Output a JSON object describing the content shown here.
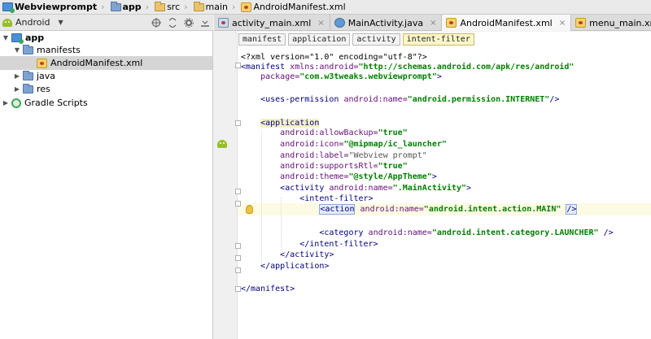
{
  "breadcrumbs": [
    {
      "label": "Webviewprompt",
      "icon": "module-icon",
      "bold": true
    },
    {
      "label": "app",
      "icon": "folder-icon",
      "bold": true
    },
    {
      "label": "src",
      "icon": "folder-icon",
      "bold": false
    },
    {
      "label": "main",
      "icon": "folder-icon",
      "bold": false
    },
    {
      "label": "AndroidManifest.xml",
      "icon": "xml-file-icon",
      "bold": false
    }
  ],
  "project_panel": {
    "view_label": "Android",
    "tree": [
      {
        "label": "app",
        "indent": 0,
        "arrow": "▼",
        "icon": "module-icon",
        "selected": false
      },
      {
        "label": "manifests",
        "indent": 1,
        "arrow": "▼",
        "icon": "folder-icon",
        "selected": false
      },
      {
        "label": "AndroidManifest.xml",
        "indent": 2,
        "arrow": "",
        "icon": "xml-file-icon",
        "selected": true
      },
      {
        "label": "java",
        "indent": 1,
        "arrow": "▶",
        "icon": "folder-icon",
        "selected": false
      },
      {
        "label": "res",
        "indent": 1,
        "arrow": "▶",
        "icon": "folder-icon",
        "selected": false
      },
      {
        "label": "Gradle Scripts",
        "indent": 0,
        "arrow": "▶",
        "icon": "gradle-icon",
        "selected": false
      }
    ]
  },
  "tabs": [
    {
      "label": "activity_main.xml",
      "icon": "layout-file-icon",
      "active": false
    },
    {
      "label": "MainActivity.java",
      "icon": "java-file-icon",
      "active": false
    },
    {
      "label": "AndroidManifest.xml",
      "icon": "xml-file-icon",
      "active": true
    },
    {
      "label": "menu_main.xml",
      "icon": "menu-file-icon",
      "active": false
    }
  ],
  "tab_close_glyph": "×",
  "xml_breadcrumbs": [
    "manifest",
    "application",
    "activity",
    "intent-filter"
  ],
  "code": {
    "l1": "<?xml version=\"1.0\" encoding=\"utf-8\"?>",
    "l2_tag": "<manifest",
    "l2_attr": "xmlns:android=",
    "l2_val": "\"http://schemas.android.com/apk/res/android\"",
    "l3_attr": "package=",
    "l3_val": "\"com.w3tweaks.webviewprompt\"",
    "l3_end": ">",
    "l5_tag": "<uses-permission",
    "l5_attr": "android:name=",
    "l5_val": "\"android.permission.INTERNET\"",
    "l5_end": "/>",
    "l7_tag": "<application",
    "l8_attr": "android:allowBackup=",
    "l8_val": "\"true\"",
    "l9_attr": "android:icon=",
    "l9_val": "\"@mipmap/ic_launcher\"",
    "l10_attr": "android:label=",
    "l10_val": "\"Webview prompt\"",
    "l11_attr": "android:supportsRtl=",
    "l11_val": "\"true\"",
    "l12_attr": "android:theme=",
    "l12_val": "\"@style/AppTheme\"",
    "l12_end": ">",
    "l13_tag": "<activity",
    "l13_attr": "android:name=",
    "l13_val": "\".MainActivity\"",
    "l13_end": ">",
    "l14_tag": "<intent-filter>",
    "l15_tag": "<action",
    "l15_attr": "android:name=",
    "l15_val": "\"android.intent.action.MAIN\"",
    "l15_end": "/>",
    "l17_tag": "<category",
    "l17_attr": "android:name=",
    "l17_val": "\"android.intent.category.LAUNCHER\"",
    "l17_end": "/>",
    "l18_tag": "</intent-filter>",
    "l19_tag": "</activity>",
    "l20_tag": "</application>",
    "l22_tag": "</manifest>"
  }
}
